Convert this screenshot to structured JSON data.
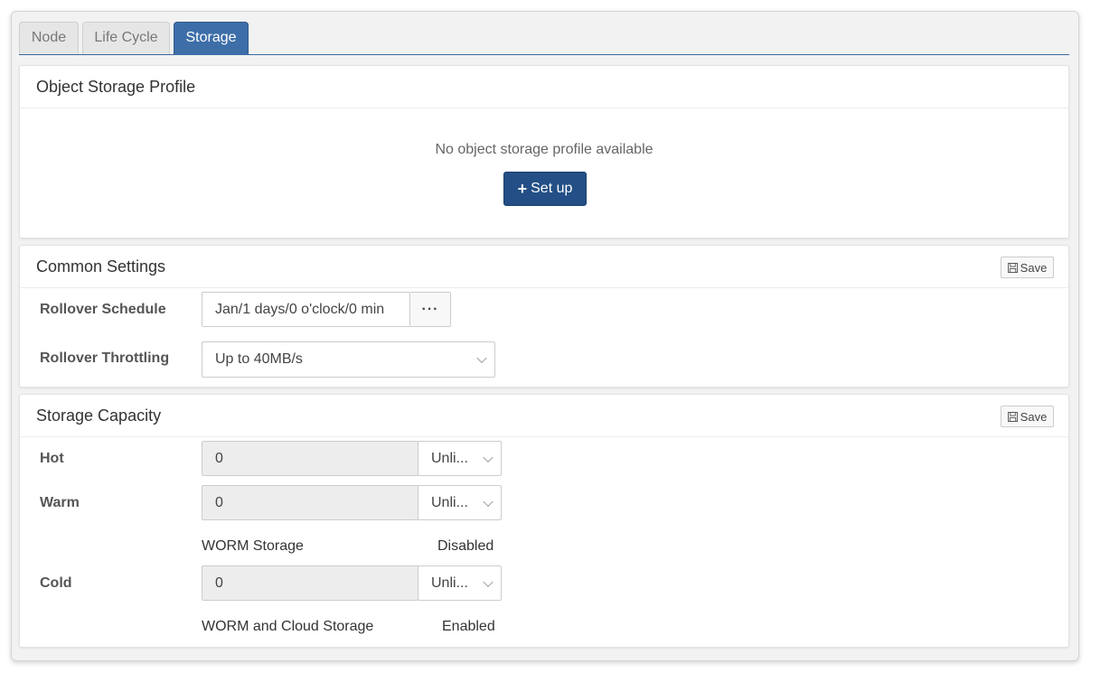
{
  "tabs": [
    {
      "label": "Node",
      "active": false
    },
    {
      "label": "Life Cycle",
      "active": false
    },
    {
      "label": "Storage",
      "active": true
    }
  ],
  "object_storage": {
    "title": "Object Storage Profile",
    "empty_message": "No object storage profile available",
    "setup_label": "Set up"
  },
  "common_settings": {
    "title": "Common Settings",
    "save_label": "Save",
    "rollover_schedule_label": "Rollover Schedule",
    "rollover_schedule_value": "Jan/1 days/0 o'clock/0 min",
    "more_label": "···",
    "rollover_throttling_label": "Rollover Throttling",
    "rollover_throttling_value": "Up to 40MB/s"
  },
  "storage_capacity": {
    "title": "Storage Capacity",
    "save_label": "Save",
    "hot": {
      "label": "Hot",
      "value": "0",
      "unit": "Unli..."
    },
    "warm": {
      "label": "Warm",
      "value": "0",
      "unit": "Unli...",
      "option_label": "WORM Storage",
      "option_status": "Disabled"
    },
    "cold": {
      "label": "Cold",
      "value": "0",
      "unit": "Unli...",
      "option_label": "WORM and Cloud Storage",
      "option_status": "Enabled"
    }
  },
  "colors": {
    "active_tab": "#3d6ea8",
    "primary_button": "#234f86"
  }
}
